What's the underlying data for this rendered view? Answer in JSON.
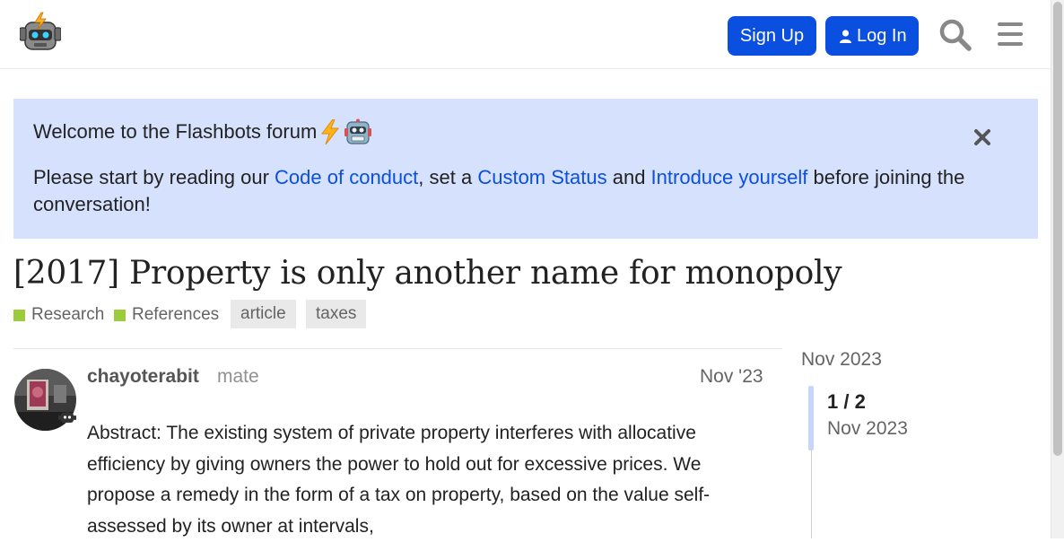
{
  "header": {
    "signup_label": "Sign Up",
    "login_label": "Log In",
    "logo_icon": "flashbots-robot-logo",
    "search_icon": "search-icon",
    "menu_icon": "hamburger-menu-icon",
    "accent": "#0a4fe0"
  },
  "banner": {
    "title": "Welcome to the Flashbots forum",
    "text_before": "Please start by reading our ",
    "link_conduct": "Code of conduct",
    "text_mid1": ", set a ",
    "link_status": "Custom Status",
    "text_mid2": " and ",
    "link_intro": "Introduce yourself",
    "text_after": " before joining the conversation!",
    "background": "#d6e1fd"
  },
  "topic": {
    "title": "[2017] Property is only another name for monopoly",
    "categories": [
      "Research",
      "References"
    ],
    "category_color": "#9ccb3c",
    "tags": [
      "article",
      "taxes"
    ]
  },
  "post": {
    "username": "chayoterabit",
    "user_title": "mate",
    "date": "Nov '23",
    "body": "Abstract: The existing system of private property interferes with allocative efficiency by giving owners the power to hold out for excessive prices. We propose a remedy in the form of a tax on property, based on the value self-assessed by its owner at intervals,"
  },
  "timeline": {
    "start_date": "Nov 2023",
    "position": "1 / 2",
    "current_date": "Nov 2023"
  }
}
